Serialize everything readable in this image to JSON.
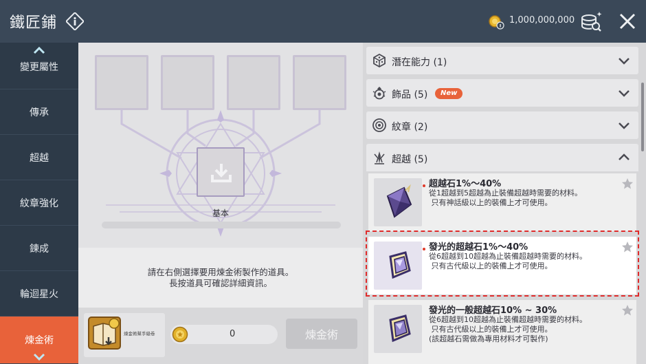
{
  "header": {
    "title": "鐵匠鋪",
    "currency_amount": "1,000,000,000"
  },
  "sidebar": {
    "items": [
      {
        "label": "變更屬性"
      },
      {
        "label": "傳承"
      },
      {
        "label": "超越"
      },
      {
        "label": "紋章強化"
      },
      {
        "label": "鍊成"
      },
      {
        "label": "輪迴星火"
      },
      {
        "label": "煉金術"
      }
    ],
    "active": "煉金術"
  },
  "center": {
    "basic_label": "基本",
    "progress": 0.0,
    "instruction_line1": "請在右側選擇要用煉金術製作的道具。",
    "instruction_line2": "長按道具可確認詳細資訊。",
    "ticket_label": "煉金術幫手級卷",
    "quantity": "0",
    "alchemy_button": "煉金術"
  },
  "right": {
    "categories": [
      {
        "label": "潛在能力 (1)",
        "icon": "dice-icon",
        "expanded": false
      },
      {
        "label": "飾品 (5)",
        "icon": "accessory-icon",
        "badge": "New",
        "expanded": false
      },
      {
        "label": "紋章 (2)",
        "icon": "emblem-icon",
        "expanded": false
      },
      {
        "label": "超越 (5)",
        "icon": "transcend-icon",
        "expanded": true
      }
    ],
    "items": [
      {
        "name": "超越石1%～40%",
        "desc": "從1超越到5超越為止裝備超越時需要的材料。\n 只有神話級以上的裝備上才可使用。"
      },
      {
        "name": "發光的超越石1%～40%",
        "desc": "從6超越到10超越為止裝備超越時需要的材料。\n 只有古代級以上的裝備上才可使用。",
        "selected": true
      },
      {
        "name": "發光的一般超越石10% ~ 30%",
        "desc": "從6超越到10超越為止裝備超越時需要的材料。\n 只有古代級以上的裝備上才可使用。\n(該超越石需做為專用材料才可製作)"
      }
    ]
  },
  "colors": {
    "accent": "#e8623a",
    "selection_border": "#e02b2b",
    "header_bg": "#3a4858",
    "sidebar_bg": "#2d3a48"
  }
}
